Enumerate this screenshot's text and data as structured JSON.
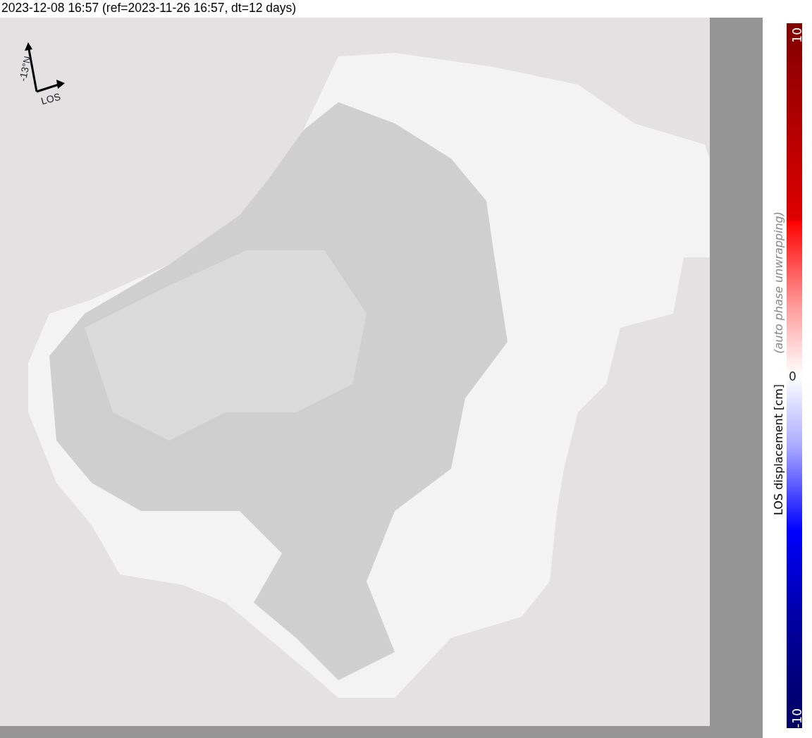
{
  "title": "2023-12-08 16:57 (ref=2023-11-26 16:57, dt=12 days)",
  "compass": {
    "north_label": "-13°N",
    "los_label": "LOS"
  },
  "colorbar": {
    "label": "LOS displacement [cm]",
    "note": "(auto phase unwrapping)",
    "max_tick": "10",
    "mid_tick": "0",
    "min_tick": "-10"
  }
}
